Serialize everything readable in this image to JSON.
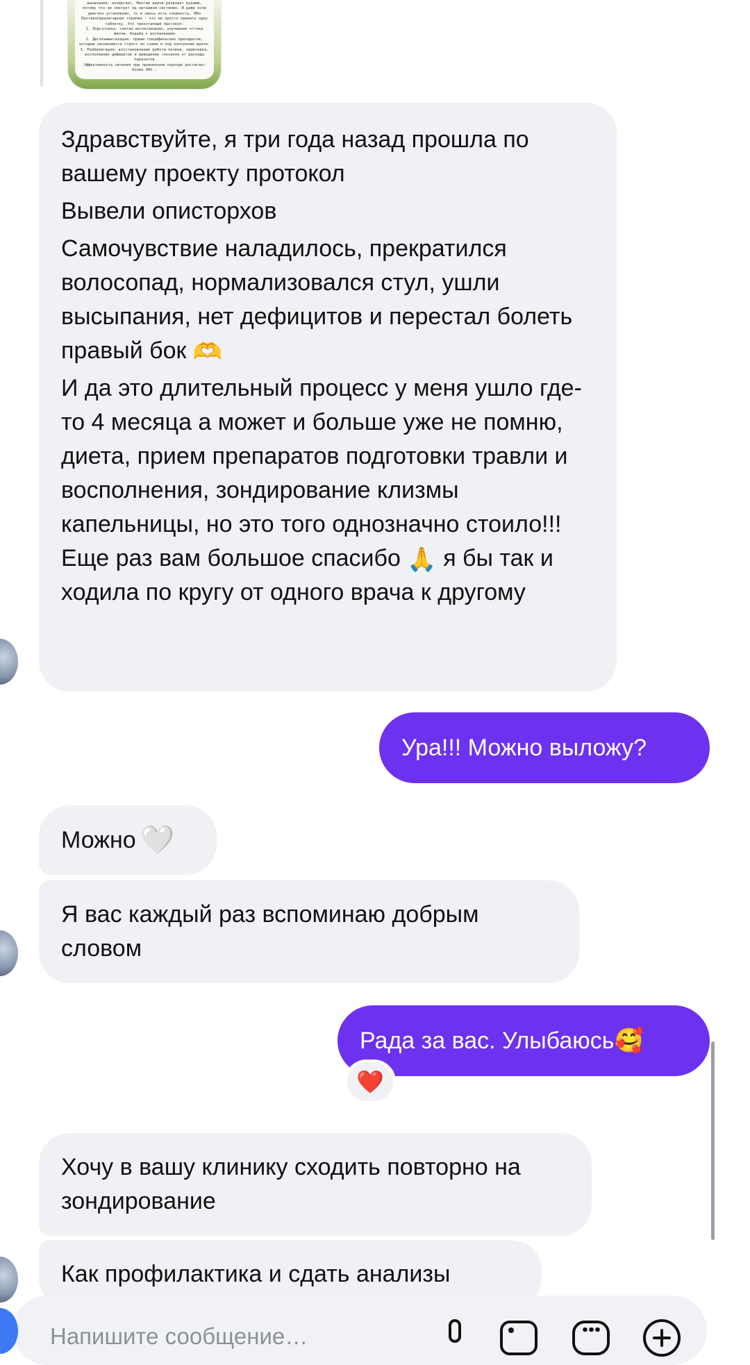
{
  "shared_post": {
    "lines": [
      "высыпания, аллергии). Многие врачи разводят руками,",
      "потому что не смотрят на организм системно. И даже если",
      "диагноз установлен, то и здесь есть сложность. Ибо",
      "Противопаразитарная терапия - это не просто принять одну",
      "таблетку. Это трехэтапный протокол:",
      "1. Подготовка: снятие интоксикации, улучшение оттока",
      "желчи, борьба с воспалением",
      "2. Дегельминтизация: прием специфических препаратов,",
      "которые назначаются строго по схеме и под контролем врача.",
      "3. Реабилитация: восстановление работы печени, кишечника,",
      "восполнение дефицитов и выведение токсинов от распада",
      "паразитов",
      "Эффективность лечения при правильном подходе достигает",
      "более 98% ."
    ]
  },
  "messages": {
    "long": {
      "paragraphs": [
        "Здравствуйте, я три года назад прошла по вашему проекту протокол",
        "Вывели описторхов",
        "Самочувствие наладилось, прекратился волосопад, нормализовался стул, ушли высыпания, нет дефицитов и перестал болеть правый бок",
        "И да это длительный процесс у меня ушло где-то 4 месяца а может и больше уже не помню, диета, прием препаратов подготовки травли и восполнения, зондирование клизмы капельницы, но это того однозначно стоило!!! Еще раз вам большое спасибо"
      ],
      "ending": "я бы так и ходила по кругу от одного врача к другому",
      "emoji_heart_hands": "🫶",
      "emoji_pray": "🙏"
    },
    "ura": {
      "text": "Ура!!! Можно выложу?"
    },
    "mozhno": {
      "text": "Можно",
      "emoji": "🤍"
    },
    "vspominayu": {
      "text": "Я вас каждый раз вспоминаю добрым словом"
    },
    "rada": {
      "text": "Рада за вас. Улыбаюсь",
      "emoji": "🥰",
      "reaction": "❤️"
    },
    "hochu": {
      "text": "Хочу в вашу клинику сходить повторно на зондирование"
    },
    "analizy": {
      "text": "Как профилактика и сдать  анализы"
    }
  },
  "composer": {
    "placeholder": "Напишите сообщение…"
  },
  "colors": {
    "incoming_bubble": "#eff1f5",
    "outgoing_bubble": "#6d31f0",
    "reaction_heart": "#e3213b"
  },
  "icons": [
    "mic-icon",
    "gallery-icon",
    "sticker-icon",
    "plus-icon",
    "camera-icon"
  ]
}
